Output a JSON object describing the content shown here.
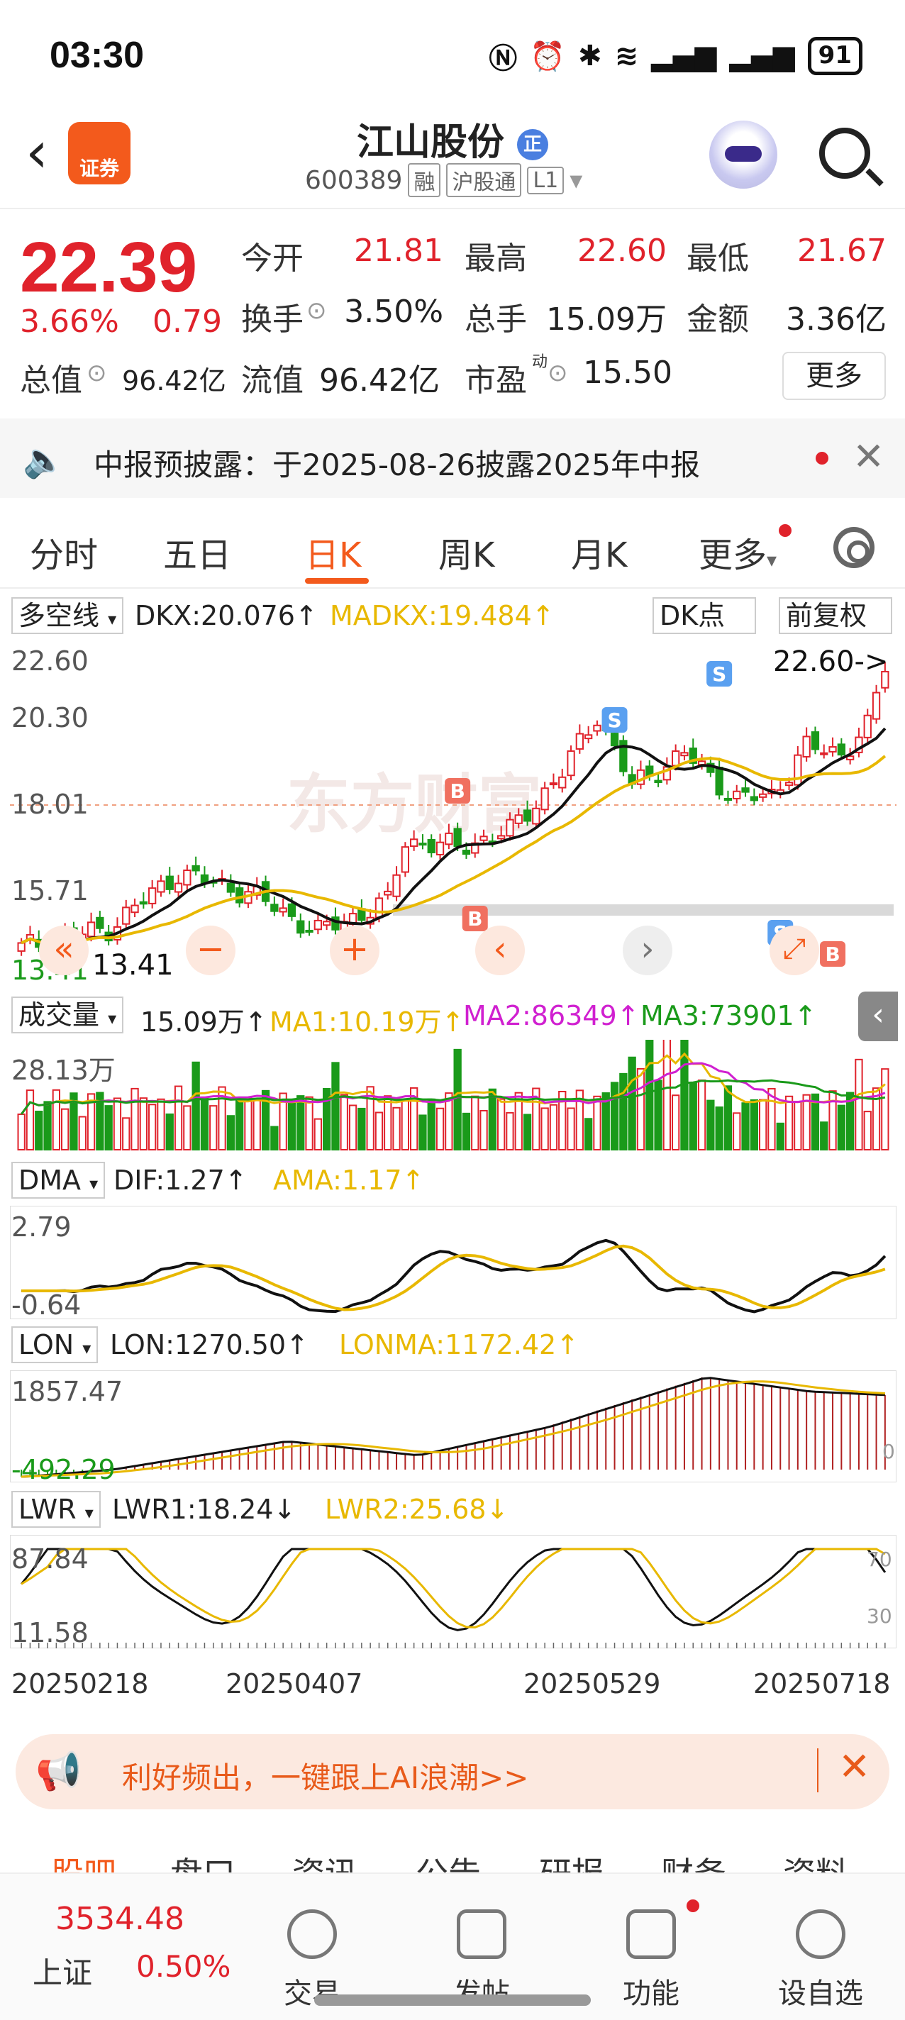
{
  "status_bar": {
    "time": "03:30",
    "battery": "91"
  },
  "header": {
    "back": "‹",
    "logo_text": "证券",
    "title": "江山股份",
    "title_badge": "正",
    "code": "600389",
    "tags": [
      "融",
      "沪股通",
      "L1"
    ]
  },
  "quote": {
    "price": "22.39",
    "change_pct": "3.66%",
    "change": "0.79",
    "open_label": "今开",
    "open": "21.81",
    "high_label": "最高",
    "high": "22.60",
    "low_label": "最低",
    "low": "21.67",
    "turnover_label": "换手",
    "turnover": "3.50%",
    "volume_label": "总手",
    "volume": "15.09万",
    "amount_label": "金额",
    "amount": "3.36亿",
    "mktcap_label": "总值",
    "mktcap": "96.42亿",
    "float_label": "流值",
    "float": "96.42亿",
    "pe_label": "市盈",
    "pe_sup": "动",
    "pe": "15.50",
    "more": "更多"
  },
  "notice": {
    "text": "中报预披露：于2025-08-26披露2025年中报"
  },
  "tabs": [
    "分时",
    "五日",
    "日K",
    "周K",
    "月K",
    "更多"
  ],
  "kline": {
    "selector": "多空线",
    "dkx": "DKX:20.076↑",
    "madkx": "MADKX:19.484↑",
    "dk_btn": "DK点",
    "adjust_btn": "前复权",
    "y_labels": [
      "22.60",
      "20.30",
      "18.01",
      "15.71",
      "13.41"
    ],
    "high_label": "22.60->",
    "low_label": "13.41",
    "markers": [
      "B",
      "S",
      "B",
      "S",
      "B",
      "S"
    ],
    "watermark": "东方财富"
  },
  "volume": {
    "selector": "成交量",
    "value": "15.09万↑",
    "ma1": "MA1:10.19万↑",
    "ma2": "MA2:86349↑",
    "ma3": "MA3:73901↑",
    "y_top": "28.13万"
  },
  "dma": {
    "selector": "DMA",
    "dif": "DIF:1.27↑",
    "ama": "AMA:1.17↑",
    "y_top": "2.79",
    "y_bottom": "-0.64"
  },
  "lon": {
    "selector": "LON",
    "lon": "LON:1270.50↑",
    "lonma": "LONMA:1172.42↑",
    "y_top": "1857.47",
    "y_bottom": "-492.29",
    "y_zero": "0"
  },
  "lwr": {
    "selector": "LWR",
    "lwr1": "LWR1:18.24↓",
    "lwr2": "LWR2:25.68↓",
    "y_top": "87.84",
    "y_bottom": "11.58",
    "ref70": "70",
    "ref30": "30"
  },
  "dates": [
    "20250218",
    "20250407",
    "20250529",
    "20250718"
  ],
  "banner": {
    "text": "利好频出，一键跟上AI浪潮>>"
  },
  "subtabs": [
    "股吧",
    "盘口",
    "资讯",
    "公告",
    "研报",
    "财务",
    "资料"
  ],
  "bottom": {
    "index_value": "3534.48",
    "index_name": "上证",
    "index_change": "0.50%",
    "items": [
      "交易",
      "发帖",
      "功能",
      "设自选"
    ]
  },
  "colors": {
    "up": "#e0222b",
    "down": "#1a9a1a",
    "accent": "#f35a1c",
    "yellow": "#e8b800",
    "magenta": "#d020d0"
  }
}
